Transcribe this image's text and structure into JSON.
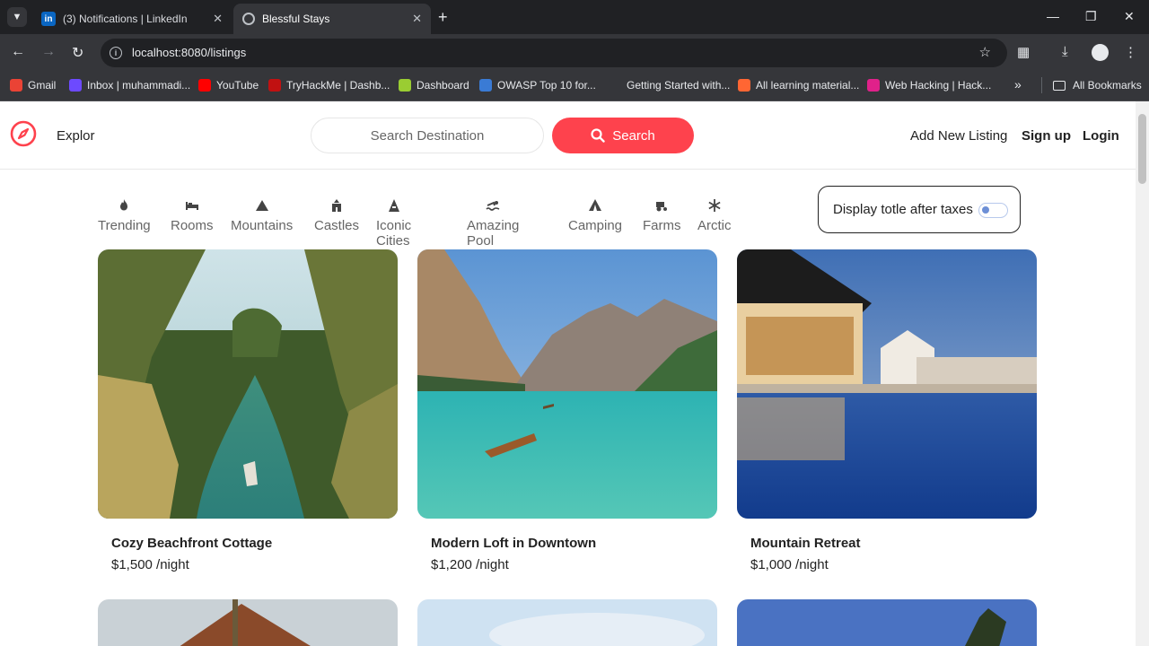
{
  "browser": {
    "tabs": [
      {
        "title": "(3) Notifications | LinkedIn",
        "favicon": "linkedin-icon",
        "active": false
      },
      {
        "title": "Blessful Stays",
        "favicon": "globe-icon",
        "active": true
      }
    ],
    "url": "localhost:8080/listings",
    "bookmarks": [
      {
        "label": "Gmail",
        "icon": "gmail-icon",
        "color": "#ea4335"
      },
      {
        "label": "Inbox | muhammadi...",
        "icon": "proton-icon",
        "color": "#6d4aff"
      },
      {
        "label": "YouTube",
        "icon": "youtube-icon",
        "color": "#ff0000"
      },
      {
        "label": "TryHackMe | Dashb...",
        "icon": "tryhackme-icon",
        "color": "#c11111"
      },
      {
        "label": "Dashboard",
        "icon": "dashboard-icon",
        "color": "#9acd32"
      },
      {
        "label": "OWASP Top 10 for...",
        "icon": "owasp-icon",
        "color": "#3a7bd5"
      },
      {
        "label": "Getting Started with...",
        "icon": "blank-icon",
        "color": "#35363a"
      },
      {
        "label": "All learning material...",
        "icon": "burp-icon",
        "color": "#ff6633"
      },
      {
        "label": "Web Hacking | Hack...",
        "icon": "hackthebox-icon",
        "color": "#e0218a"
      }
    ],
    "all_bookmarks": "All Bookmarks"
  },
  "navbar": {
    "brand": "Explor",
    "search_placeholder": "Search Destination",
    "search_button": "Search",
    "links": {
      "add_listing": "Add New Listing",
      "signup": "Sign up",
      "login": "Login"
    },
    "accent_color": "#fe424d"
  },
  "filters": [
    {
      "label": "Trending",
      "icon": "fire-icon"
    },
    {
      "label": "Rooms",
      "icon": "bed-icon"
    },
    {
      "label": "Mountains",
      "icon": "mountain-icon"
    },
    {
      "label": "Castles",
      "icon": "castle-icon"
    },
    {
      "label": "Iconic Cities",
      "icon": "city-icon"
    },
    {
      "label": "Amazing Pool",
      "icon": "swimmer-icon"
    },
    {
      "label": "Camping",
      "icon": "tent-icon"
    },
    {
      "label": "Farms",
      "icon": "tractor-icon"
    },
    {
      "label": "Arctic",
      "icon": "snowflake-icon"
    }
  ],
  "tax_toggle": {
    "label": "Display totle after taxes",
    "enabled": false
  },
  "listings": [
    {
      "title": "Cozy Beachfront Cottage",
      "price": "$1,500 /night"
    },
    {
      "title": "Modern Loft in Downtown",
      "price": "$1,200 /night"
    },
    {
      "title": "Mountain Retreat",
      "price": "$1,000 /night"
    }
  ]
}
